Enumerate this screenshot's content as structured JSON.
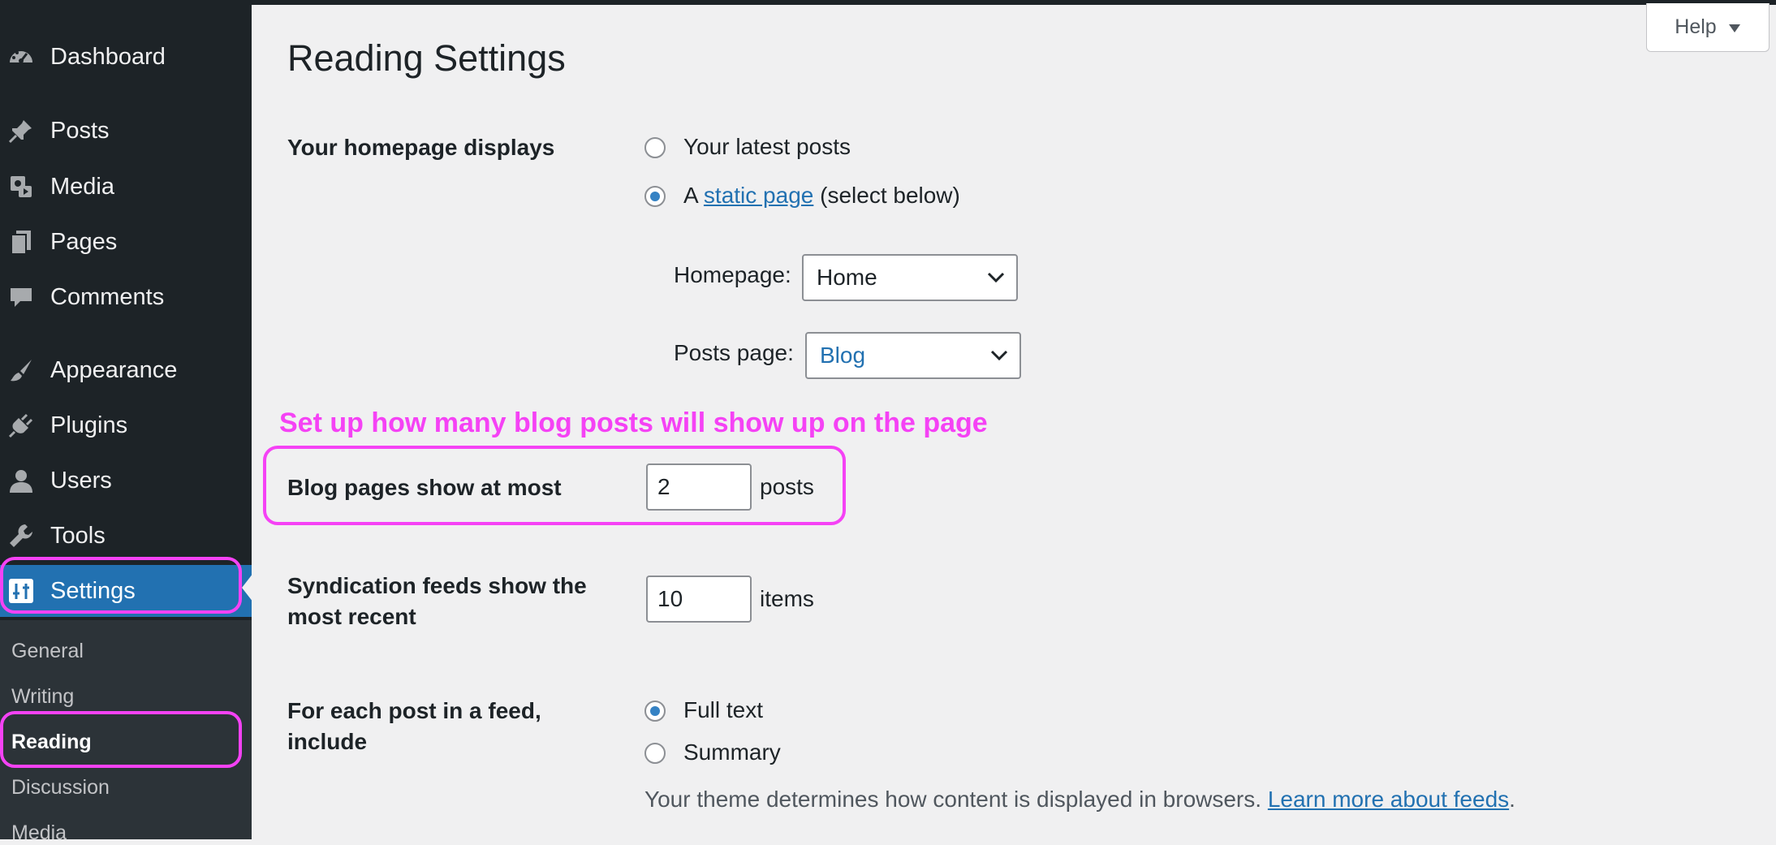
{
  "sidebar": {
    "items": [
      {
        "label": "Dashboard",
        "icon": "dashboard-icon"
      },
      {
        "label": "Posts",
        "icon": "pushpin-icon"
      },
      {
        "label": "Media",
        "icon": "media-icon"
      },
      {
        "label": "Pages",
        "icon": "pages-icon"
      },
      {
        "label": "Comments",
        "icon": "comment-icon"
      },
      {
        "label": "Appearance",
        "icon": "paintbrush-icon"
      },
      {
        "label": "Plugins",
        "icon": "plug-icon"
      },
      {
        "label": "Users",
        "icon": "user-icon"
      },
      {
        "label": "Tools",
        "icon": "wrench-icon"
      },
      {
        "label": "Settings",
        "icon": "settings-icon"
      }
    ],
    "submenu": [
      "General",
      "Writing",
      "Reading",
      "Discussion",
      "Media"
    ],
    "active_item": "Settings",
    "current_submenu": "Reading"
  },
  "help": {
    "label": "Help",
    "icon": "triangle-down-icon"
  },
  "page": {
    "title": "Reading Settings"
  },
  "homepage": {
    "label": "Your homepage displays",
    "option_latest": "Your latest posts",
    "option_static_prefix": "A",
    "option_static_link": "static page",
    "option_static_suffix": "(select below)",
    "selected": "static",
    "homepage_label": "Homepage:",
    "homepage_value": "Home",
    "posts_page_label": "Posts page:",
    "posts_page_value": "Blog"
  },
  "annotation": "Set up how many blog posts will show up on the page",
  "blog_pages": {
    "label": "Blog pages show at most",
    "value": "2",
    "unit": "posts"
  },
  "syndication": {
    "label_line1": "Syndication feeds show the",
    "label_line2": "most recent",
    "value": "10",
    "unit": "items"
  },
  "feed": {
    "label_line1": "For each post in a feed,",
    "label_line2": "include",
    "option_full": "Full text",
    "option_summary": "Summary",
    "selected": "full",
    "description": "Your theme determines how content is displayed in browsers.",
    "learn_more": "Learn more about feeds",
    "period": "."
  },
  "colors": {
    "sidebar_bg": "#1d2327",
    "submenu_bg": "#2c3338",
    "active_bg": "#2271b1",
    "highlight": "#f542f5",
    "link": "#2271b1",
    "content_bg": "#f0f0f1"
  }
}
